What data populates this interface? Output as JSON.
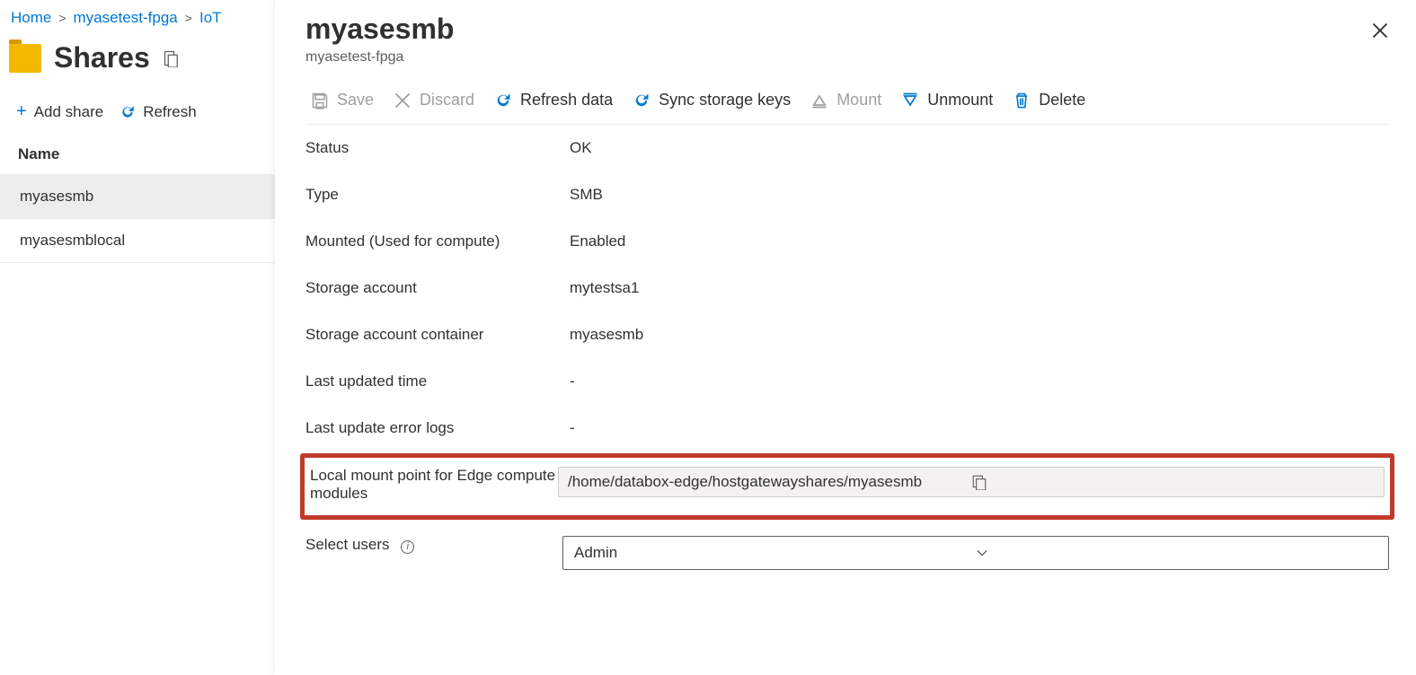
{
  "breadcrumb": {
    "home": "Home",
    "resource": "myasetest-fpga",
    "page": "IoT"
  },
  "shares": {
    "title": "Shares",
    "add_label": "Add share",
    "refresh_label": "Refresh",
    "column_name": "Name",
    "rows": [
      "myasesmb",
      "myasesmblocal"
    ]
  },
  "panel": {
    "title": "myasesmb",
    "subtitle": "myasetest-fpga",
    "toolbar": {
      "save": "Save",
      "discard": "Discard",
      "refresh_data": "Refresh data",
      "sync_keys": "Sync storage keys",
      "mount": "Mount",
      "unmount": "Unmount",
      "delete": "Delete"
    },
    "fields": {
      "status_label": "Status",
      "status_value": "OK",
      "type_label": "Type",
      "type_value": "SMB",
      "mounted_label": "Mounted (Used for compute)",
      "mounted_value": "Enabled",
      "storage_account_label": "Storage account",
      "storage_account_value": "mytestsa1",
      "container_label": "Storage account container",
      "container_value": "myasesmb",
      "last_updated_label": "Last updated time",
      "last_updated_value": "-",
      "error_logs_label": "Last update error logs",
      "error_logs_value": "-",
      "mount_point_label": "Local mount point for Edge compute modules",
      "mount_point_value": "/home/databox-edge/hostgatewayshares/myasesmb",
      "select_users_label": "Select users",
      "select_users_value": "Admin"
    }
  }
}
